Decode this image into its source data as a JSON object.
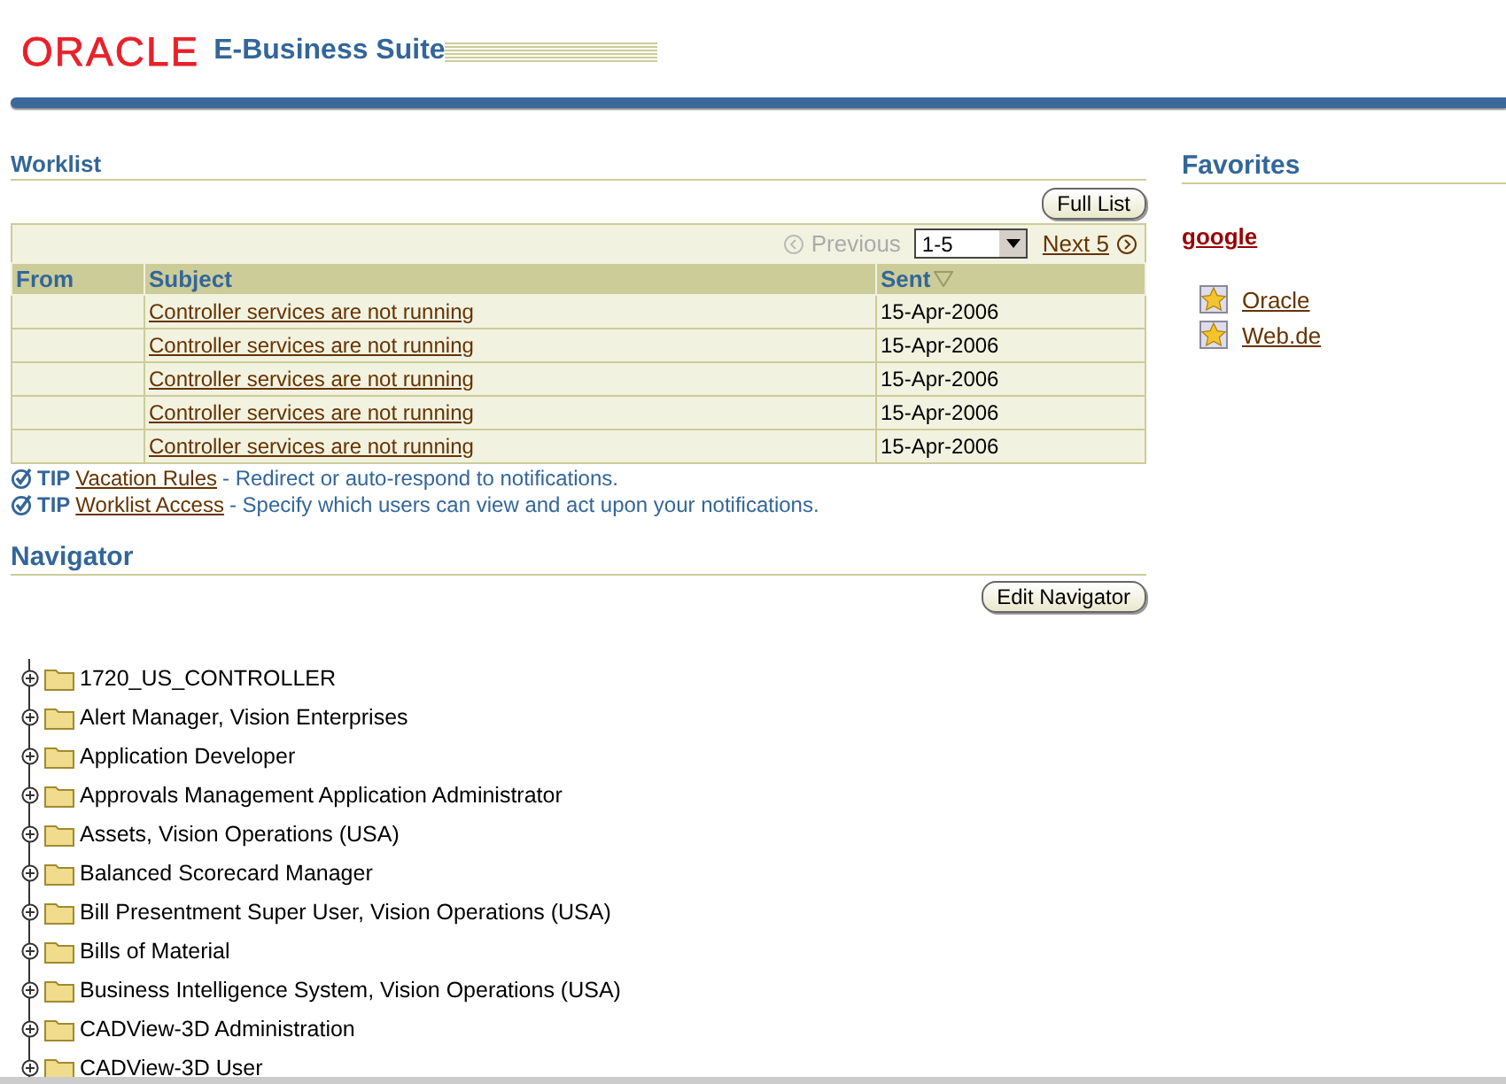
{
  "header": {
    "logo": "ORACLE",
    "product": "E-Business Suite"
  },
  "worklist": {
    "title": "Worklist",
    "full_list_button": "Full List",
    "pager": {
      "previous": "Previous",
      "previous_disabled": true,
      "range": "1-5",
      "next": "Next 5"
    },
    "columns": [
      "From",
      "Subject",
      "Sent"
    ],
    "rows": [
      {
        "from": "",
        "subject": "Controller services are not running",
        "sent": "15-Apr-2006"
      },
      {
        "from": "",
        "subject": "Controller services are not running",
        "sent": "15-Apr-2006"
      },
      {
        "from": "",
        "subject": "Controller services are not running",
        "sent": "15-Apr-2006"
      },
      {
        "from": "",
        "subject": "Controller services are not running",
        "sent": "15-Apr-2006"
      },
      {
        "from": "",
        "subject": "Controller services are not running",
        "sent": "15-Apr-2006"
      }
    ],
    "tips": [
      {
        "label": "TIP",
        "link": "Vacation Rules",
        "text": "- Redirect or auto-respond to notifications."
      },
      {
        "label": "TIP",
        "link": "Worklist Access",
        "text": "- Specify which users can view and act upon your notifications."
      }
    ]
  },
  "navigator": {
    "title": "Navigator",
    "edit_button": "Edit Navigator",
    "items": [
      {
        "label": "1720_US_CONTROLLER",
        "expanded": false
      },
      {
        "label": "Alert Manager, Vision Enterprises",
        "expanded": false
      },
      {
        "label": "Application Developer",
        "expanded": false
      },
      {
        "label": "Approvals Management Application Administrator",
        "expanded": false
      },
      {
        "label": "Assets, Vision Operations (USA)",
        "expanded": false
      },
      {
        "label": "Balanced Scorecard Manager",
        "expanded": false
      },
      {
        "label": "Bill Presentment Super User, Vision Operations (USA)",
        "expanded": false
      },
      {
        "label": "Bills of Material",
        "expanded": false
      },
      {
        "label": "Business Intelligence System, Vision Operations (USA)",
        "expanded": false
      },
      {
        "label": "CADView-3D Administration",
        "expanded": false
      },
      {
        "label": "CADView-3D User",
        "expanded": false
      }
    ]
  },
  "favorites": {
    "title": "Favorites",
    "group": "google",
    "links": [
      "Oracle",
      "Web.de"
    ]
  }
}
